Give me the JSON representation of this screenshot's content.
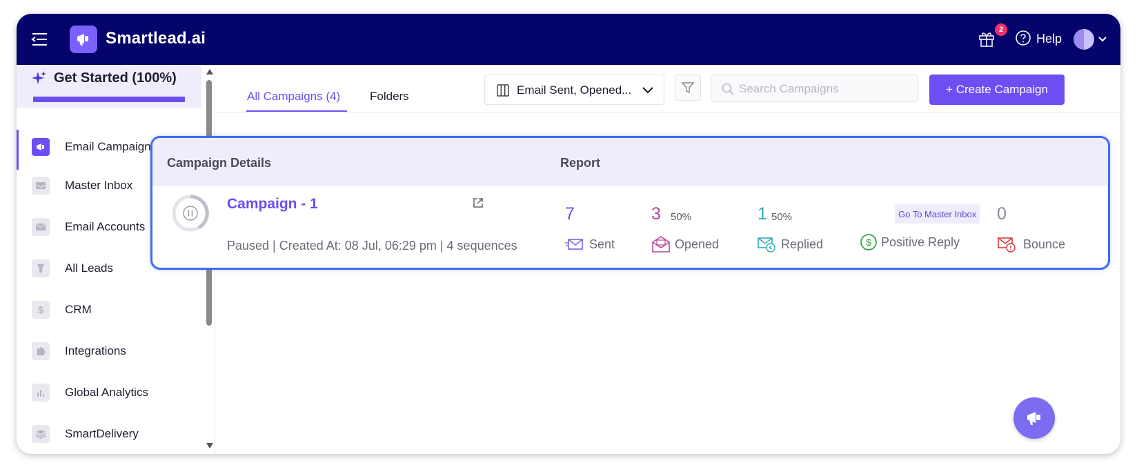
{
  "app": {
    "name": "Smartlead.ai",
    "notification_count": "2",
    "help_label": "Help"
  },
  "sidebar": {
    "get_started": {
      "label": "Get Started (100%)",
      "progress": 1.0
    },
    "items": [
      {
        "label": "Email Campaign",
        "icon": "megaphone-icon",
        "active": true
      },
      {
        "label": "Master Inbox",
        "icon": "inbox-icon",
        "active": false
      },
      {
        "label": "Email Accounts",
        "icon": "envelope-icon",
        "active": false
      },
      {
        "label": "All Leads",
        "icon": "leads-icon",
        "active": false
      },
      {
        "label": "CRM",
        "icon": "dollar-icon",
        "active": false
      },
      {
        "label": "Integrations",
        "icon": "puzzle-icon",
        "active": false
      },
      {
        "label": "Global Analytics",
        "icon": "bar-chart-icon",
        "active": false
      },
      {
        "label": "SmartDelivery",
        "icon": "layers-icon",
        "active": false
      }
    ]
  },
  "toolbar": {
    "tabs": [
      {
        "label": "All Campaigns (4)",
        "active": true
      },
      {
        "label": "Folders",
        "active": false
      }
    ],
    "columns_label": "Email Sent, Opened...",
    "search_placeholder": "Search Campaigns",
    "search_value": "",
    "create_label": "+ Create Campaign"
  },
  "card": {
    "col_details": "Campaign Details",
    "col_report": "Report",
    "campaign": {
      "name": "Campaign - 1",
      "meta": "Paused | Created At: 08 Jul, 06:29 pm | 4 sequences"
    },
    "stats": {
      "sent": {
        "value": "7",
        "label": "Sent",
        "color": "#6c4ef2"
      },
      "opened": {
        "value": "3",
        "pct": "50%",
        "label": "Opened",
        "color": "#b5479b"
      },
      "replied": {
        "value": "1",
        "pct": "50%",
        "label": "Replied",
        "color": "#34a9b8"
      },
      "positive": {
        "link": "Go To Master Inbox",
        "label": "Positive Reply",
        "color": "#2e9e3e"
      },
      "bounced": {
        "value": "0",
        "label": "Bounce",
        "color": "#d43c3c"
      }
    }
  },
  "colors": {
    "navbar": "#04046a",
    "accent": "#6c4ef2",
    "highlight_border": "#3d6cf0"
  }
}
